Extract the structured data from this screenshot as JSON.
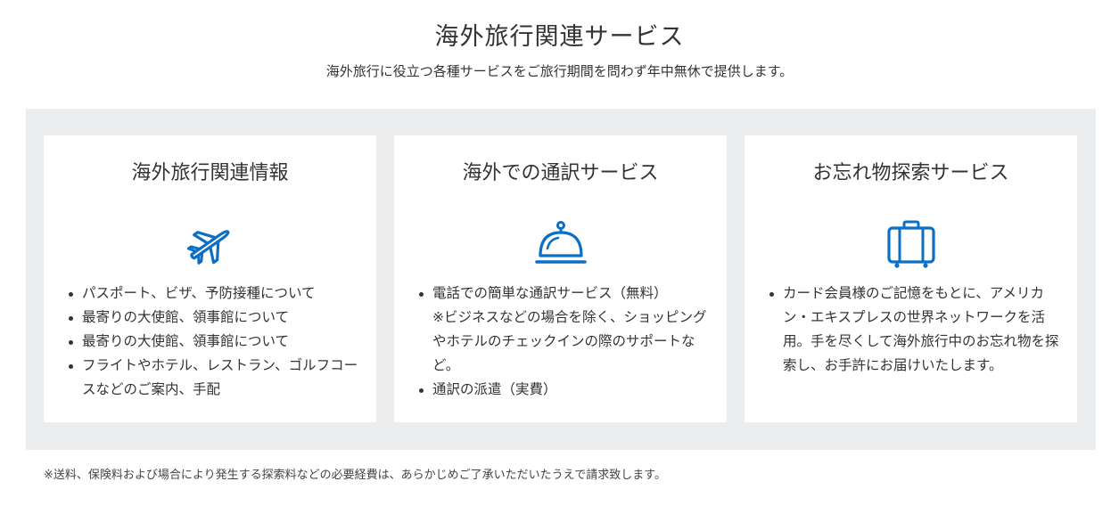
{
  "header": {
    "title": "海外旅行関連サービス",
    "subtitle": "海外旅行に役立つ各種サービスをご旅行期間を問わず年中無休で提供します。"
  },
  "accent_color": "#0b6fc6",
  "cards": [
    {
      "title": "海外旅行関連情報",
      "icon": "airplane-icon",
      "items": [
        "パスポート、ビザ、予防接種について",
        "最寄りの大使館、領事館について",
        "最寄りの大使館、領事館について",
        "フライトやホテル、レストラン、ゴルフコースなどのご案内、手配"
      ]
    },
    {
      "title": "海外での通訳サービス",
      "icon": "service-bell-icon",
      "items": [
        "電話での簡単な通訳サービス（無料）",
        "通訳の派遣（実費）"
      ],
      "note": "※ビジネスなどの場合を除く、ショッピングやホテルのチェックインの際のサポートなど。"
    },
    {
      "title": "お忘れ物探索サービス",
      "icon": "suitcase-icon",
      "items": [
        "カード会員様のご記憶をもとに、アメリカン・エキスプレスの世界ネットワークを活用。手を尽くして海外旅行中のお忘れ物を探索し、お手許にお届けいたします。"
      ]
    }
  ],
  "footnote": "※送料、保険料および場合により発生する探索料などの必要経費は、あらかじめご了承いただいたうえで請求致します。"
}
